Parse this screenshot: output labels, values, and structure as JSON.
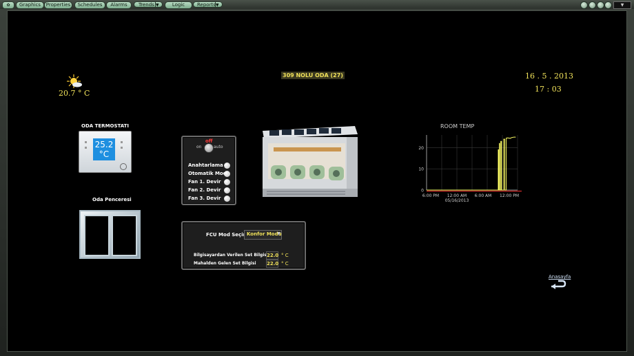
{
  "nav": {
    "tabs": [
      {
        "label": "Graphics"
      },
      {
        "label": "Properties"
      },
      {
        "label": "Schedules"
      },
      {
        "label": "Alarms"
      },
      {
        "label": "Trends"
      },
      {
        "label": "Logic"
      },
      {
        "label": "Reports"
      }
    ]
  },
  "weather": {
    "temperature": "20.7 ° C",
    "icon": "sun-cloud-icon"
  },
  "room_title": "309 NOLU ODA (27)",
  "datetime": {
    "date": "16 . 5 . 2013",
    "time": "17 : 03"
  },
  "thermostat": {
    "title": "ODA TERMOSTATI",
    "reading": "25.2",
    "unit": "°C"
  },
  "window": {
    "title": "Oda Penceresi"
  },
  "mode_panel": {
    "off_label": "off",
    "on_label": "on",
    "auto_label": "auto",
    "items": [
      {
        "label": "Anahtarlama"
      },
      {
        "label": "Otomatik Mod"
      },
      {
        "label": "Fan 1. Devir"
      },
      {
        "label": "Fan 2. Devir"
      },
      {
        "label": "Fan 3. Devir"
      }
    ]
  },
  "fcu_panel": {
    "mode_label": "FCU Mod Seçimi",
    "mode_value": "Konfor Modu",
    "rows": [
      {
        "label": "Bilgisayardan Verilen Set Bilgisi",
        "value": "22.0",
        "unit": "° C"
      },
      {
        "label": "Mahalden Gelen Set Bilgisi",
        "value": "22.0",
        "unit": "° C"
      }
    ]
  },
  "home_link": {
    "label": "Anasayfa"
  },
  "colors": {
    "accent": "#f1e25a",
    "tab": "#9fcdb0",
    "chart_line": "#ffff66",
    "chart_ref": "#ff3333"
  },
  "chart_data": {
    "type": "line",
    "title": "ROOM TEMP",
    "x_ticks": [
      "6:00 PM",
      "12:00 AM",
      "6:00 AM",
      "12:00 PM"
    ],
    "x_sublabel": "05/16/2013",
    "y_ticks": [
      "0",
      "10",
      "20"
    ],
    "ylim": [
      0,
      26
    ],
    "xlim": [
      0,
      25
    ],
    "series": [
      {
        "values": [
          [
            0,
            0
          ],
          [
            19.7,
            0
          ],
          [
            19.7,
            19
          ],
          [
            19.8,
            19
          ],
          [
            19.8,
            0
          ],
          [
            20.0,
            0
          ],
          [
            20.0,
            22
          ],
          [
            20.1,
            22
          ],
          [
            20.1,
            0
          ],
          [
            20.4,
            0
          ],
          [
            20.4,
            23
          ],
          [
            20.6,
            23
          ],
          [
            20.6,
            0
          ],
          [
            21.2,
            0
          ],
          [
            21.2,
            24
          ],
          [
            21.5,
            24
          ],
          [
            21.5,
            0
          ],
          [
            21.9,
            0
          ],
          [
            21.9,
            24.5
          ],
          [
            22.3,
            24.6
          ],
          [
            23.0,
            24.4
          ],
          [
            23.3,
            24.7
          ],
          [
            24.0,
            25.0
          ],
          [
            24.5,
            25.0
          ]
        ]
      }
    ],
    "reference_line": {
      "y": 0
    },
    "grid": true
  }
}
